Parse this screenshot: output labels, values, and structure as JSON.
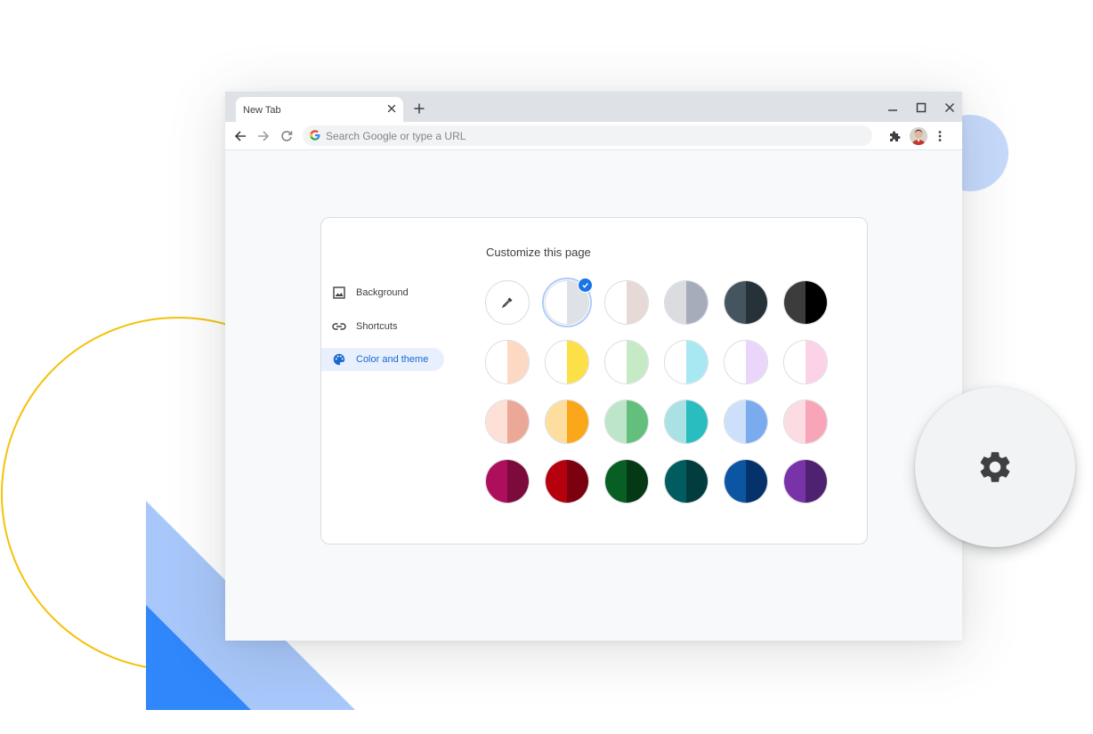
{
  "colors": {
    "accent": "#1a73e8",
    "tabstrip": "#dee1e6",
    "deco_yellow": "#f4c20d",
    "deco_light_blue": "#a8c7fa",
    "deco_blue": "#2f87fb",
    "deco_pale_blue": "#c6dafc"
  },
  "browser": {
    "tab": {
      "title": "New Tab",
      "close_icon": "close-icon"
    },
    "new_tab_icon": "plus-icon",
    "window_controls": [
      "minimize-icon",
      "maximize-icon",
      "close-icon"
    ],
    "toolbar": {
      "back_icon": "arrow-left-icon",
      "forward_icon": "arrow-right-icon",
      "reload_icon": "reload-icon",
      "omnibox_placeholder": "Search Google or type a URL",
      "extensions_icon": "puzzle-icon",
      "menu_icon": "more-vert-icon"
    }
  },
  "customize": {
    "title": "Customize this page",
    "nav": [
      {
        "label": "Background",
        "icon": "image-icon",
        "active": false
      },
      {
        "label": "Shortcuts",
        "icon": "link-icon",
        "active": false
      },
      {
        "label": "Color and theme",
        "icon": "palette-icon",
        "active": true
      }
    ],
    "themes": [
      {
        "name": "custom",
        "left": "#ffffff",
        "right": "#f1f3f4",
        "custom": true,
        "icon": "eyedropper-icon"
      },
      {
        "name": "default",
        "left": "#ffffff",
        "right": "#dee1e6",
        "selected": true
      },
      {
        "name": "warm-grey",
        "left": "#ffffff",
        "right": "#e6d9d6"
      },
      {
        "name": "cool-grey",
        "left": "#dadce0",
        "right": "#a5acba"
      },
      {
        "name": "midnight-blue",
        "left": "#45555f",
        "right": "#263238"
      },
      {
        "name": "black",
        "left": "#3c3c3c",
        "right": "#000000"
      },
      {
        "name": "beige-white",
        "left": "#ffffff",
        "right": "#fdd9c4"
      },
      {
        "name": "yellow-white",
        "left": "#ffffff",
        "right": "#fde047"
      },
      {
        "name": "green-white",
        "left": "#ffffff",
        "right": "#c6eac6"
      },
      {
        "name": "light-teal-white",
        "left": "#ffffff",
        "right": "#a8e8f2"
      },
      {
        "name": "light-purple-white",
        "left": "#ffffff",
        "right": "#ead6fa"
      },
      {
        "name": "pink-white",
        "left": "#ffffff",
        "right": "#fcd3e6"
      },
      {
        "name": "peach",
        "left": "#fde0d6",
        "right": "#eba896"
      },
      {
        "name": "orange",
        "left": "#fdde9e",
        "right": "#faa719"
      },
      {
        "name": "green",
        "left": "#bde5c9",
        "right": "#63bf7c"
      },
      {
        "name": "light-teal",
        "left": "#a9e1e4",
        "right": "#2abdc0"
      },
      {
        "name": "light-blue",
        "left": "#cde0fb",
        "right": "#7aabee"
      },
      {
        "name": "light-pink",
        "left": "#fcdbe3",
        "right": "#f8a5b9"
      },
      {
        "name": "dark-pink-red",
        "left": "#ad0f5c",
        "right": "#7c0b3b"
      },
      {
        "name": "dark-red-orange",
        "left": "#b5000d",
        "right": "#7b0010"
      },
      {
        "name": "dark-green",
        "left": "#075f24",
        "right": "#053815"
      },
      {
        "name": "dark-teal",
        "left": "#005c5f",
        "right": "#013c3f"
      },
      {
        "name": "dark-blue",
        "left": "#0c55a2",
        "right": "#05326a"
      },
      {
        "name": "purple",
        "left": "#7833a9",
        "right": "#4e2270"
      }
    ]
  },
  "settings_fab": {
    "icon": "gear-icon"
  }
}
